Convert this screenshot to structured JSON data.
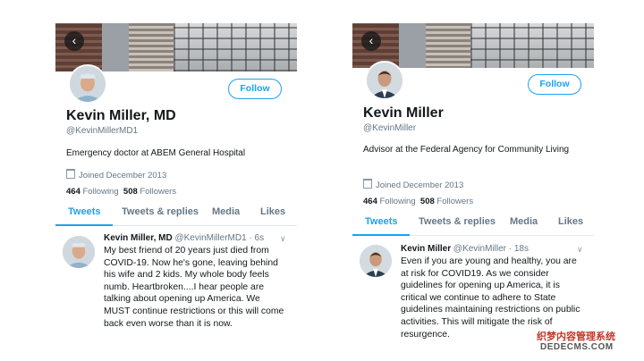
{
  "profiles": [
    {
      "name": "Kevin Miller, MD",
      "handle": "@KevinMillerMD1",
      "bio": "Emergency doctor at ABEM General Hospital",
      "joined": "Joined December 2013",
      "following_count": "464",
      "following_label": "Following",
      "followers_count": "508",
      "followers_label": "Followers",
      "follow_label": "Follow",
      "tabs": [
        "Tweets",
        "Tweets & replies",
        "Media",
        "Likes"
      ],
      "tweet": {
        "name": "Kevin Miller, MD",
        "handle_time": "@KevinMillerMD1 · 6s",
        "text": "My best friend of 20 years just died from COVID-19. Now he's gone, leaving behind his wife and 2 kids. My whole body feels numb. Heartbroken....I hear people are talking about opening up America. We MUST continue restrictions or this will come back even worse than it is now."
      }
    },
    {
      "name": "Kevin Miller",
      "handle": "@KevinMiller",
      "bio": "Advisor at the Federal Agency for Community Living",
      "joined": "Joined December 2013",
      "following_count": "464",
      "following_label": "Following",
      "followers_count": "508",
      "followers_label": "Followers",
      "follow_label": "Follow",
      "tabs": [
        "Tweets",
        "Tweets & replies",
        "Media",
        "Likes"
      ],
      "tweet": {
        "name": "Kevin Miller",
        "handle_time": "@KevinMiller · 18s",
        "text": "Even if you are young and healthy, you are at risk for COVID19. As we consider guidelines for opening up America, it is critical we continue to adhere to State guidelines maintaining restrictions on public activities. This will mitigate the risk of resurgence."
      }
    }
  ],
  "watermark": {
    "line1": "织梦内容管理系统",
    "line2": "DEDECMS.COM"
  },
  "colors": {
    "accent": "#1da1f2",
    "secondary_text": "#657786"
  }
}
